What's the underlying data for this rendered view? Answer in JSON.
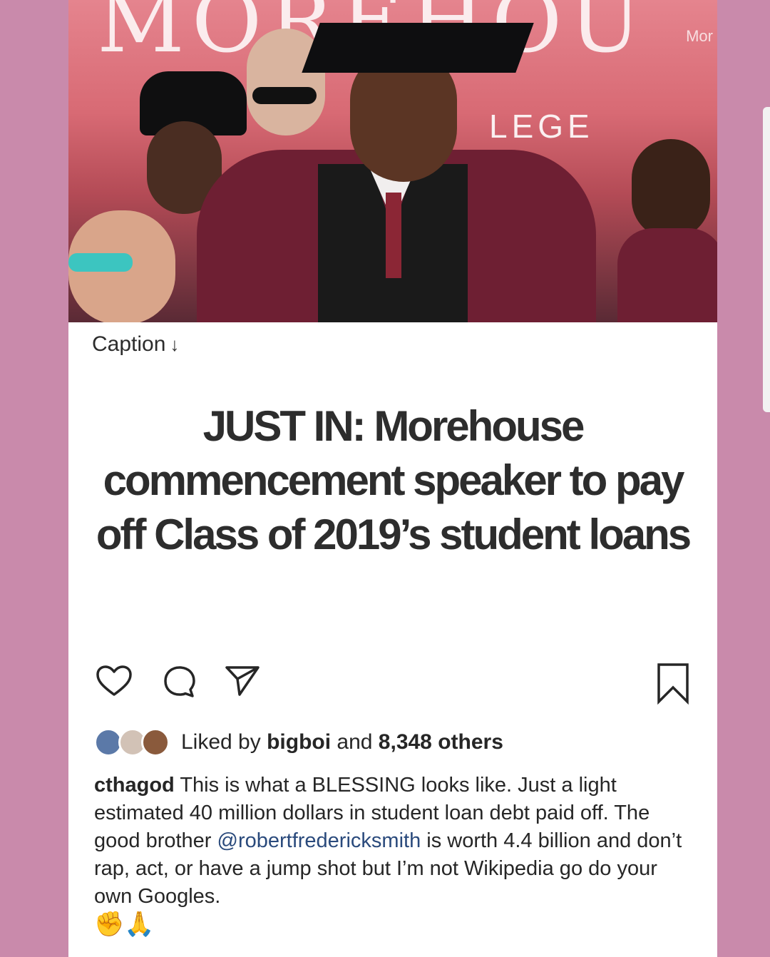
{
  "photo": {
    "banner_text": "MOREHOU",
    "banner_sub": "LEGE",
    "watermark": "Mor"
  },
  "caption_label": "Caption",
  "caption_arrow": "↓",
  "headline": "JUST IN: Morehouse commencement speaker to pay off Class of 2019’s student loans",
  "actions": {
    "icons": [
      "heart-icon",
      "comment-icon",
      "share-icon",
      "bookmark-icon"
    ]
  },
  "likes": {
    "prefix": "Liked by ",
    "user": "bigboi",
    "middle": " and ",
    "count": "8,348 others"
  },
  "post": {
    "username": "cthagod",
    "text_1": " This is what a BLESSING looks like. Just a light estimated 40 million dollars in student loan debt paid off. The good brother ",
    "mention": "@robertfredericksmith",
    "text_2": " is worth 4.4 billion and don’t rap, act, or have a jump shot but I’m not Wikipedia go do your own Googles.",
    "emojis": "✊🙏"
  },
  "colors": {
    "background": "#c98aab",
    "card": "#ffffff",
    "text": "#262626",
    "mention": "#2a4a7c"
  }
}
